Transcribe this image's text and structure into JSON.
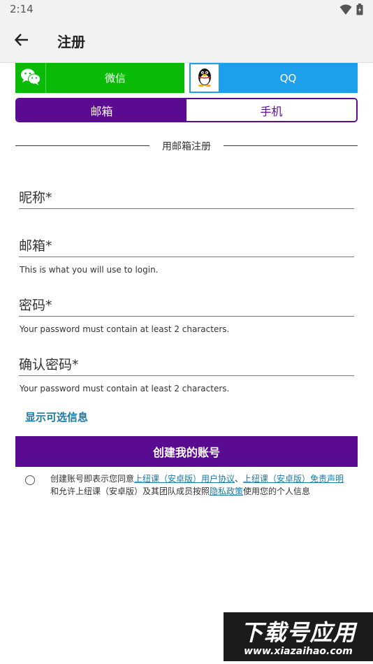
{
  "status_bar": {
    "time": "2:14",
    "icons": [
      "wifi-icon",
      "battery-icon"
    ]
  },
  "app_bar": {
    "back_icon": "arrow-left-icon",
    "title": "注册"
  },
  "social": {
    "wechat_label": "微信",
    "qq_label": "QQ",
    "wechat_color": "#09bb07",
    "qq_color": "#1da0ec"
  },
  "toggle": {
    "email_label": "邮箱",
    "phone_label": "手机",
    "active": "email",
    "accent": "#5b0a92"
  },
  "divider_text": "用邮箱注册",
  "fields": {
    "nickname": {
      "label": "昵称*"
    },
    "email": {
      "label": "邮箱*",
      "helper": "This is what you will use to login."
    },
    "password": {
      "label": "密码*",
      "helper": "Your password must contain at least 2 characters."
    },
    "confirm": {
      "label": "确认密码*",
      "helper": "Your password must contain at least 2 characters."
    }
  },
  "optional_link": "显示可选信息",
  "submit_label": "创建我的账号",
  "agreement": {
    "prefix": "创建账号即表示您同意",
    "link1": "上纽课（安卓版）用户协议",
    "sep": "、",
    "link2": "上纽课（安卓版）免责声明",
    "middle": "和允许上纽课（安卓版）及其团队成员按照",
    "link3": "隐私政策",
    "suffix": "使用您的个人信息"
  },
  "watermark": {
    "big": "下载号应用",
    "small": "www.xiazaihao.com"
  }
}
